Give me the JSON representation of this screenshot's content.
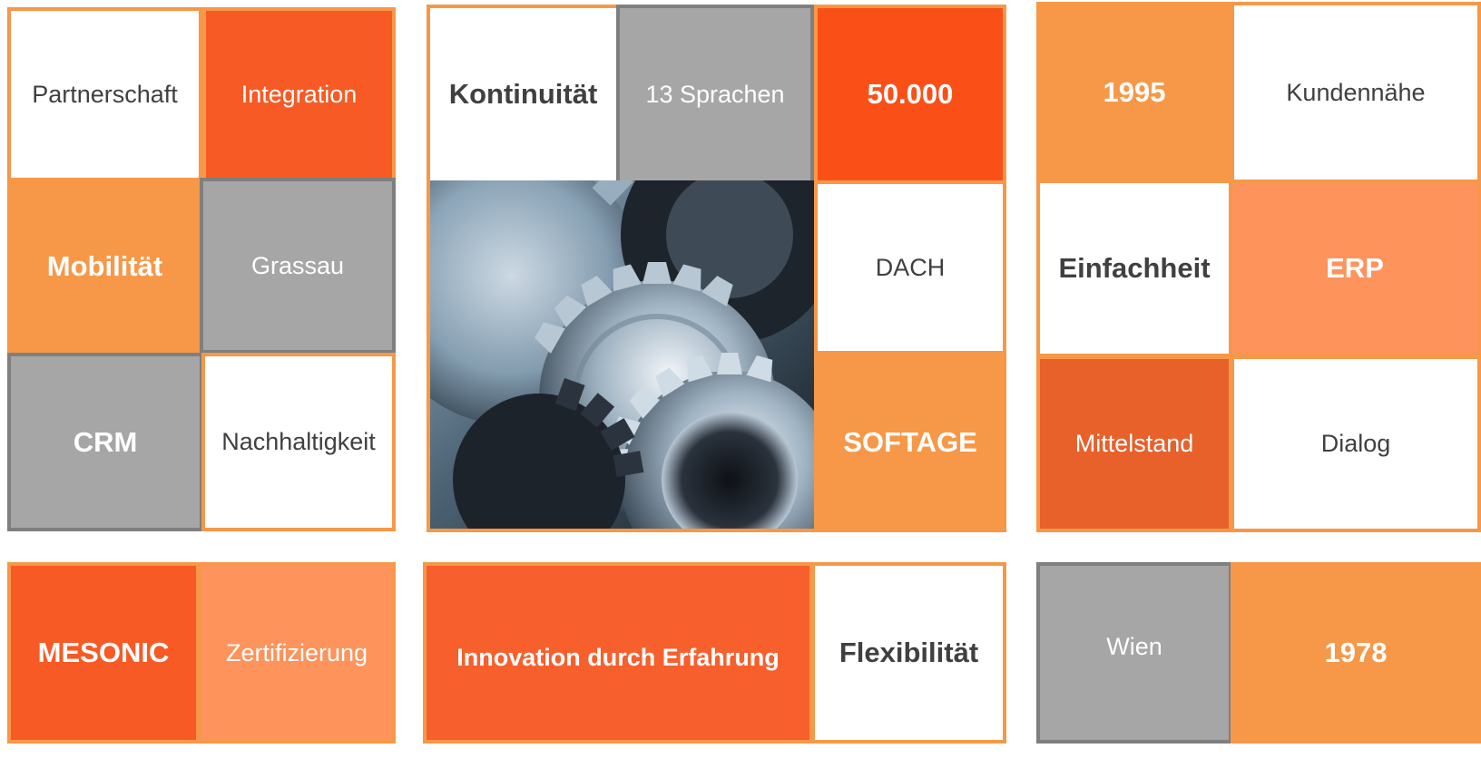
{
  "colors": {
    "orange": "#F69848",
    "orange_deep": "#FA5018",
    "orange_red": "#F75F2C",
    "orange_mid": "#E8602A",
    "orange_light": "#FE935C",
    "gray": "#A6A6A6",
    "gray_border": "#7F7F7F",
    "white": "#FFFFFF",
    "text_dark": "#404040"
  },
  "tiles": {
    "partnerschaft": "Partnerschaft",
    "integration": "Integration",
    "mobilitaet": "Mobilität",
    "grassau": "Grassau",
    "crm": "CRM",
    "nachhaltigkeit": "Nachhaltigkeit",
    "kontinuitaet": "Kontinuität",
    "sprachen": "13 Sprachen",
    "fuenfzigtausend": "50.000",
    "dach": "DACH",
    "softage": "SOFTAGE",
    "jahr_1995": "1995",
    "kundennaehe": "Kundennähe",
    "einfachheit": "Einfachheit",
    "erp": "ERP",
    "mittelstand": "Mittelstand",
    "dialog": "Dialog",
    "mesonic": "MESONIC",
    "zertifizierung": "Zertifizierung",
    "innovation": "Innovation durch Erfahrung",
    "flexibilitaet": "Flexibilität",
    "wien": "Wien",
    "jahr_1978": "1978"
  },
  "photo": {
    "icon": "gears-photo"
  }
}
